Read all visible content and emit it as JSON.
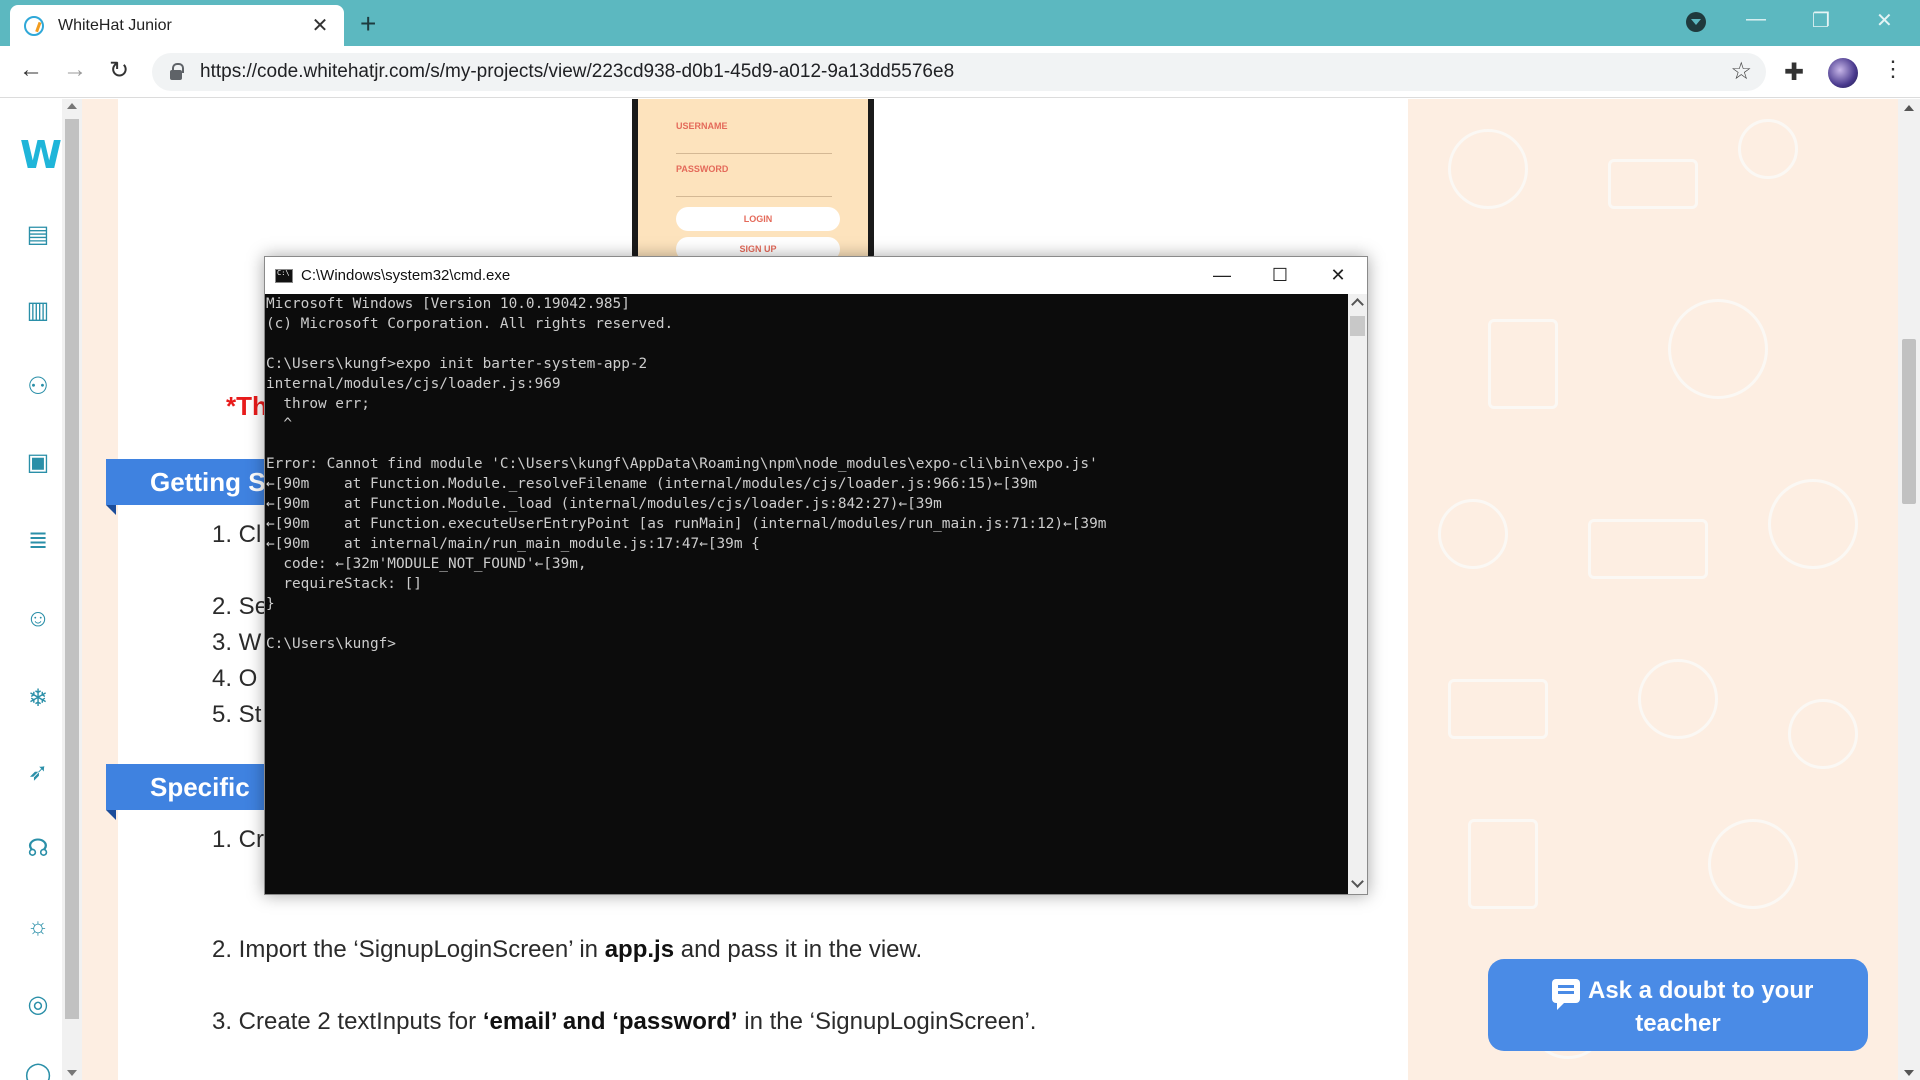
{
  "browser": {
    "tab_title": "WhiteHat Junior",
    "tab_close": "✕",
    "new_tab": "+",
    "url": "https://code.whitehatjr.com/s/my-projects/view/223cd938-d0b1-45d9-a012-9a13dd5576e8",
    "window_controls": [
      "—",
      "❐",
      "✕"
    ]
  },
  "sidebar": {
    "logo": "W",
    "icons": [
      "dashboard-icon",
      "book-icon",
      "activity-icon",
      "notebook-icon",
      "notes-icon",
      "emoji-icon",
      "snowflake-icon",
      "rocket-icon",
      "support-icon",
      "bulb-icon",
      "profile-icon",
      "more-icon"
    ]
  },
  "phone": {
    "username_label": "USERNAME",
    "password_label": "PASSWORD",
    "login": "LOGIN",
    "signup": "SIGN UP"
  },
  "content": {
    "red_note": "*Th",
    "section1": "Getting S",
    "section1_items": [
      "1. Cl",
      "2. Se",
      "3. W",
      "4. O",
      "5. St"
    ],
    "section2": "Specific T",
    "section2_item1": "1. Cr",
    "item2_pre": "2. Import the ‘SignupLoginScreen’ in ",
    "item2_bold": "app.js",
    "item2_post": " and pass it in the view.",
    "item3_pre": "3. Create 2 textInputs for ",
    "item3_bold": "‘email’ and ‘password’",
    "item3_post": " in the ‘SignupLoginScreen’."
  },
  "cmd": {
    "title": "C:\\Windows\\system32\\cmd.exe",
    "lines": [
      "Microsoft Windows [Version 10.0.19042.985]",
      "(c) Microsoft Corporation. All rights reserved.",
      "",
      "C:\\Users\\kungf>expo init barter-system-app-2",
      "internal/modules/cjs/loader.js:969",
      "  throw err;",
      "  ^",
      "",
      "Error: Cannot find module 'C:\\Users\\kungf\\AppData\\Roaming\\npm\\node_modules\\expo-cli\\bin\\expo.js'",
      "←[90m    at Function.Module._resolveFilename (internal/modules/cjs/loader.js:966:15)←[39m",
      "←[90m    at Function.Module._load (internal/modules/cjs/loader.js:842:27)←[39m",
      "←[90m    at Function.executeUserEntryPoint [as runMain] (internal/modules/run_main.js:71:12)←[39m",
      "←[90m    at internal/main/run_main_module.js:17:47←[39m {",
      "  code: ←[32m'MODULE_NOT_FOUND'←[39m,",
      "  requireStack: []",
      "}",
      "",
      "C:\\Users\\kungf>"
    ]
  },
  "doubt_button": {
    "line1": "Ask a doubt to your",
    "line2": "teacher"
  },
  "colors": {
    "tab_bar": "#5cb8c0",
    "accent_blue": "#3f82e0",
    "red_note": "#e81b1b",
    "pattern": "#fdeee2"
  }
}
